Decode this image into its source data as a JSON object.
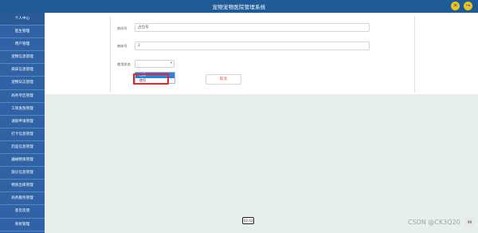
{
  "app_title": "宠物宠物医院管理系统",
  "sidebar": {
    "items": [
      {
        "label": "个人中心"
      },
      {
        "label": "医生管理"
      },
      {
        "label": "用户管理"
      },
      {
        "label": "宠物信息管理"
      },
      {
        "label": "病床信息管理"
      },
      {
        "label": "宠物日志管理"
      },
      {
        "label": "商务专区管理"
      },
      {
        "label": "工资发放管理"
      },
      {
        "label": "请假申请管理"
      },
      {
        "label": "打卡信息管理"
      },
      {
        "label": "药品信息管理"
      },
      {
        "label": "器械物资管理"
      },
      {
        "label": "就诊信息管理"
      },
      {
        "label": "物资出库管理"
      },
      {
        "label": "商务服务管理"
      },
      {
        "label": "意见反馈"
      },
      {
        "label": "系统管理"
      }
    ]
  },
  "form": {
    "room_label": "房间号",
    "room_value": "占位号",
    "bed_label": "病床号",
    "bed_value": "2",
    "status_label": "使用状态",
    "status_value": "",
    "options": [
      "占用",
      "使用"
    ],
    "cancel_label": "取消"
  },
  "status": {
    "time": "03:43",
    "corner": "99"
  },
  "watermark": "CSDN @CK3Q20",
  "colors": {
    "header_bg": "#1e5b98",
    "sidebar_bg": "#2f63a5",
    "content_bg": "#e6efea",
    "accent": "#f0c41b",
    "highlight": "#e0282c"
  }
}
